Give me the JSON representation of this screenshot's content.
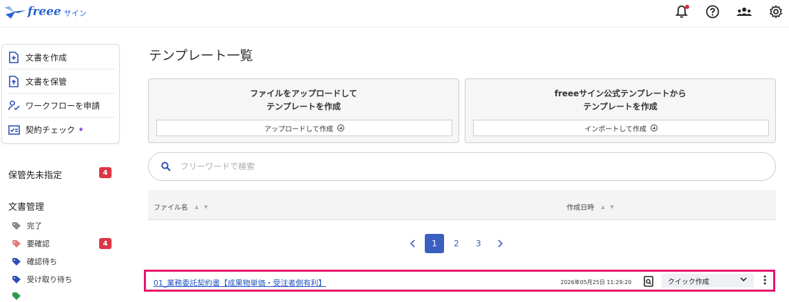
{
  "header": {
    "logo_text": "freee",
    "logo_sub": "サイン",
    "icons": [
      "bell-icon",
      "help-icon",
      "team-icon",
      "gear-icon"
    ],
    "notification_dot_color": "#e0203a"
  },
  "menu": {
    "items": [
      {
        "label": "文書を作成",
        "icon": "file-plus-icon"
      },
      {
        "label": "文書を保管",
        "icon": "file-upload-icon"
      },
      {
        "label": "ワークフローを申請",
        "icon": "workflow-icon"
      },
      {
        "label": "契約チェック",
        "icon": "contract-check-icon"
      }
    ]
  },
  "sidebar": {
    "unassigned_label": "保管先未指定",
    "unassigned_count": "4",
    "docs_heading": "文書管理",
    "tags": [
      {
        "label": "完了",
        "color": "#888888"
      },
      {
        "label": "要確認",
        "color": "#e07a7a",
        "count": "4"
      },
      {
        "label": "確認待ち",
        "color": "#2c4fb8"
      },
      {
        "label": "受け取り待ち",
        "color": "#2c4fb8"
      }
    ]
  },
  "main": {
    "title": "テンプレート一覧",
    "upload_card": {
      "title_line1": "ファイルをアップロードして",
      "title_line2": "テンプレートを作成",
      "button": "アップロードして作成"
    },
    "import_card": {
      "title_line1": "freeeサイン公式テンプレートから",
      "title_line2": "テンプレートを作成",
      "button": "インポートして作成"
    },
    "search_placeholder": "フリーワードで検索",
    "columns": {
      "file_name": "ファイル名",
      "created_at": "作成日時"
    },
    "pagination": {
      "pages": [
        "1",
        "2",
        "3"
      ],
      "current": "1"
    },
    "rows": [
      {
        "file_name": "01_業務委託契約書【成果物単価・受注者側有利】",
        "created_at": "2026年05月25日 11:29:20",
        "quick_action": "クイック作成"
      }
    ]
  },
  "colors": {
    "accent": "#3b5fc0",
    "highlight_border": "#e5136b",
    "badge": "#dc3545"
  }
}
